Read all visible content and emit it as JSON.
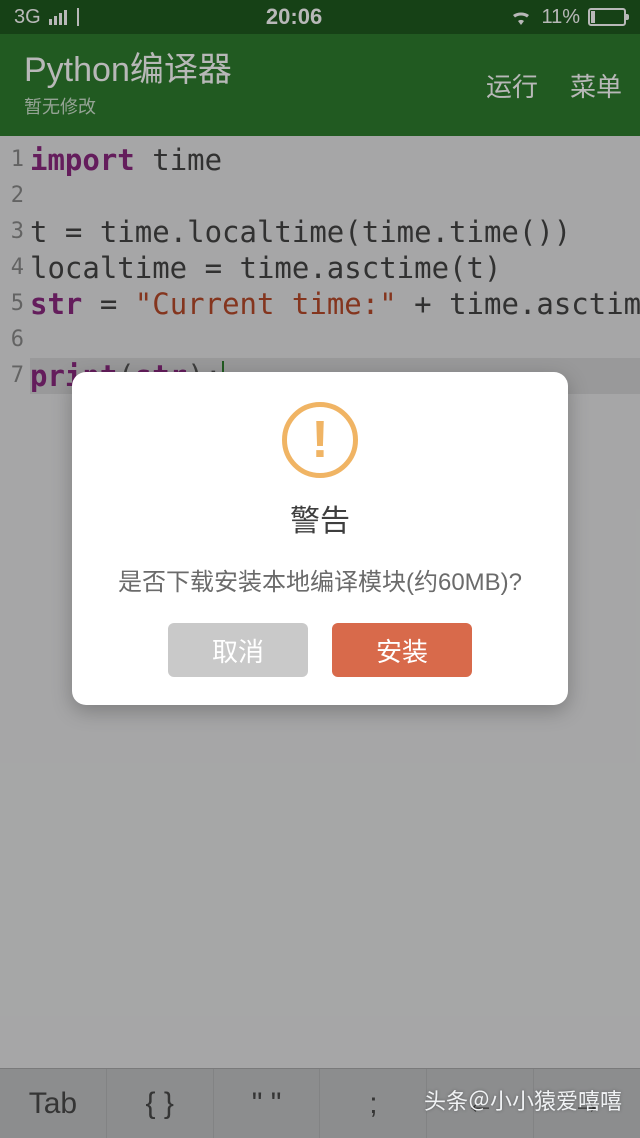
{
  "status": {
    "network": "3G",
    "time": "20:06",
    "battery_pct": "11%"
  },
  "header": {
    "title": "Python编译器",
    "subtitle": "暂无修改",
    "run": "运行",
    "menu": "菜单"
  },
  "code": {
    "lines": [
      {
        "n": "1",
        "tokens": [
          {
            "t": "import",
            "c": "kw"
          },
          {
            "t": " ",
            "c": ""
          },
          {
            "t": "time",
            "c": "ident"
          }
        ]
      },
      {
        "n": "2",
        "tokens": []
      },
      {
        "n": "3",
        "tokens": [
          {
            "t": "t = time.localtime(time.time())",
            "c": "ident"
          }
        ]
      },
      {
        "n": "4",
        "tokens": [
          {
            "t": "localtime = time.asctime(t)",
            "c": "ident"
          }
        ]
      },
      {
        "n": "5",
        "tokens": [
          {
            "t": "str",
            "c": "kw"
          },
          {
            "t": " = ",
            "c": "ident"
          },
          {
            "t": "\"Current time:\"",
            "c": "str"
          },
          {
            "t": " + time.asctime",
            "c": "ident"
          }
        ]
      },
      {
        "n": "6",
        "tokens": []
      },
      {
        "n": "7",
        "tokens": [
          {
            "t": "print",
            "c": "kw"
          },
          {
            "t": "(",
            "c": "punct"
          },
          {
            "t": "str",
            "c": "kw"
          },
          {
            "t": ");",
            "c": "punct"
          }
        ],
        "hl": true,
        "cursor": true
      }
    ]
  },
  "dialog": {
    "title": "警告",
    "message": "是否下载安装本地编译模块(约60MB)?",
    "cancel": "取消",
    "install": "安装"
  },
  "keybar": {
    "items": [
      "Tab",
      "{ }",
      "\" \"",
      ";",
      "←",
      "→"
    ]
  },
  "watermark": "头条＠小小猿爱嘻嘻"
}
